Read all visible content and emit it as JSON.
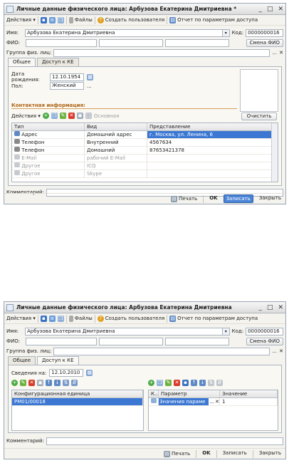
{
  "win1": {
    "title": "Личные данные физического лица: Арбузова Екатерина Дмитриевна *",
    "controls": [
      "_",
      "□",
      "✕"
    ],
    "toolbar": {
      "actions": "Действия ▾",
      "files": "Файлы",
      "create_user": "Создать пользователя",
      "report": "Отчет по параметрам доступа"
    },
    "name_label": "Имя:",
    "name_value": "Арбузова Екатерина Дмитриевна",
    "code_label": "Код:",
    "code_value": "0000000016",
    "fio_label": "ФИО:",
    "fio_button": "Смена ФИО",
    "group_label": "Группа физ. лиц:",
    "tabs": [
      "Общее",
      "Доступ к КЕ"
    ],
    "birth_label": "Дата рождения:",
    "birth_value": "12.10.1954",
    "sex_label": "Пол:",
    "sex_value": "Женский",
    "contact_header": "Контактная информация:",
    "contact_actions": "Действия ▾",
    "main_label": "Основная",
    "clear_button": "Очистить",
    "columns": [
      "Тип",
      "Вид",
      "Представление"
    ],
    "rows": [
      {
        "type": "Адрес",
        "kind": "Домашний адрес",
        "value": "г. Москва, ул. Ленина, 6"
      },
      {
        "type": "Телефон",
        "kind": "Внутренний",
        "value": "4567634"
      },
      {
        "type": "Телефон",
        "kind": "Домашний",
        "value": "87653421378"
      },
      {
        "type": "E-Mail",
        "kind": "рабочий E-Mail",
        "value": ""
      },
      {
        "type": "Другое",
        "kind": "ICQ",
        "value": ""
      },
      {
        "type": "Другое",
        "kind": "Skype",
        "value": ""
      }
    ],
    "comment_label": "Комментарий:",
    "status": {
      "print": "Печать",
      "ok": "OK",
      "save": "Записать",
      "close": "Закрыть"
    }
  },
  "win2": {
    "title": "Личные данные физического лица: Арбузова Екатерина Дмитриевна",
    "controls": [
      "_",
      "□",
      "✕"
    ],
    "toolbar": {
      "actions": "Действия ▾",
      "files": "Файлы",
      "create_user": "Создать пользователя",
      "report": "Отчет по параметрам доступа"
    },
    "name_label": "Имя:",
    "name_value": "Арбузова Екатерина Дмитриевна",
    "code_label": "Код:",
    "code_value": "0000000016",
    "fio_label": "ФИО:",
    "fio_button": "Смена ФИО",
    "group_label": "Группа физ. лиц:",
    "tabs": [
      "Общее",
      "Доступ к КЕ"
    ],
    "info_label": "Сведения на:",
    "info_value": "12.10.2010",
    "left_col": "Конфигурационная единица",
    "left_rows": [
      "PM01/00018"
    ],
    "right_cols": [
      "К...",
      "Параметр",
      "Значение"
    ],
    "right_rows": [
      {
        "param": "Значения параме",
        "value": "1"
      }
    ],
    "comment_label": "Комментарий:",
    "status": {
      "print": "Печать",
      "ok": "OK",
      "save": "Записать",
      "close": "Закрыть"
    }
  }
}
